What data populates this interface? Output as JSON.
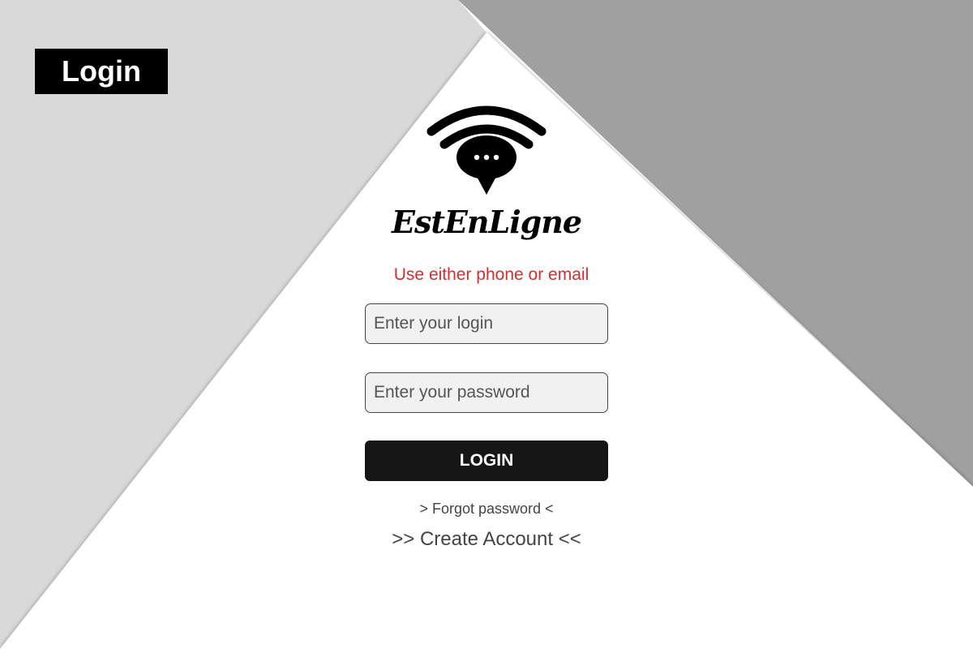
{
  "page_label": "Login",
  "brand": {
    "name": "EstEnLigne",
    "logo_icon": "wifi-chat-bubble-icon"
  },
  "hint": "Use either phone or email",
  "form": {
    "login_placeholder": "Enter your login",
    "password_placeholder": "Enter your password",
    "login_button": "LOGIN"
  },
  "links": {
    "forgot_password": "> Forgot password <",
    "create_account": ">> Create Account <<"
  },
  "colors": {
    "hint": "#d32f2f",
    "button_bg": "#161616",
    "bg_light_gray": "#d9d9d9",
    "bg_dark_gray": "#a0a0a0"
  }
}
